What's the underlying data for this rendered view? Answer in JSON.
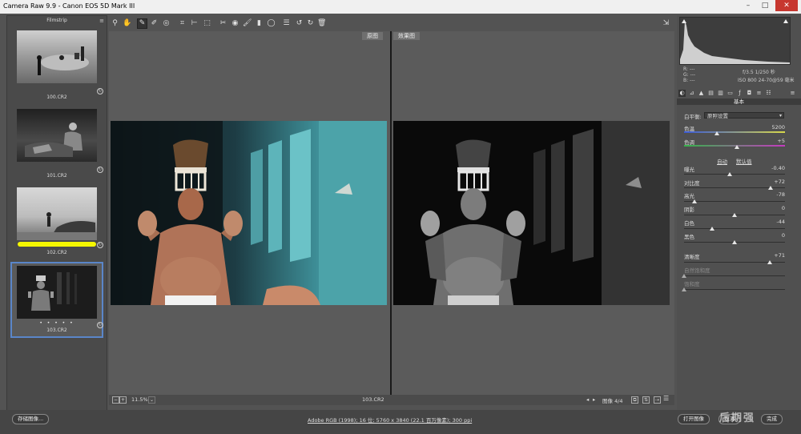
{
  "window": {
    "title": "Camera Raw 9.9 -  Canon EOS 5D Mark III",
    "min": "–",
    "max": "□",
    "close": "✕"
  },
  "filmstrip": {
    "title": "Filmstrip",
    "menu_icon": "≡",
    "items": [
      {
        "name": "100.CR2"
      },
      {
        "name": "101.CR2"
      },
      {
        "name": "102.CR2"
      },
      {
        "name": "103.CR2",
        "stars": "• • • • •"
      }
    ]
  },
  "toolbar": {
    "open_prefs_icon": "⇲"
  },
  "preview": {
    "before_label": "原图",
    "after_label": "效果图",
    "zoom": "11.5%",
    "filename": "103.CR2",
    "image_count": "图像 4/4"
  },
  "histogram": {
    "rgb": {
      "r": "R:  ---",
      "g": "G:  ---",
      "b": "B:  ---"
    },
    "aperture_shutter": "f/3.5   1/250 秒",
    "iso_lens": "ISO 800   24-70@59 毫米"
  },
  "panel": {
    "title": "基本",
    "wb_label": "白平衡:",
    "wb_value": "原照设置",
    "temp_label": "色温",
    "temp_value": "5200",
    "tint_label": "色调",
    "tint_value": "+5",
    "auto": "自动",
    "default": "默认值",
    "exposure_label": "曝光",
    "exposure_value": "-0.40",
    "contrast_label": "对比度",
    "contrast_value": "+72",
    "highlights_label": "高光",
    "highlights_value": "-78",
    "shadows_label": "阴影",
    "shadows_value": "0",
    "whites_label": "白色",
    "whites_value": "-44",
    "blacks_label": "黑色",
    "blacks_value": "0",
    "clarity_label": "清晰度",
    "clarity_value": "+71",
    "vibrance_label": "自然饱和度",
    "saturation_label": "饱和度"
  },
  "bottombar": {
    "save": "存储图像...",
    "workflow": "Adobe RGB (1998); 16 位; 5760 x 3840 (22.1 百万像素); 300 ppi",
    "open": "打开图像",
    "cancel": "取消",
    "done": "完成",
    "watermark": "后期强"
  }
}
